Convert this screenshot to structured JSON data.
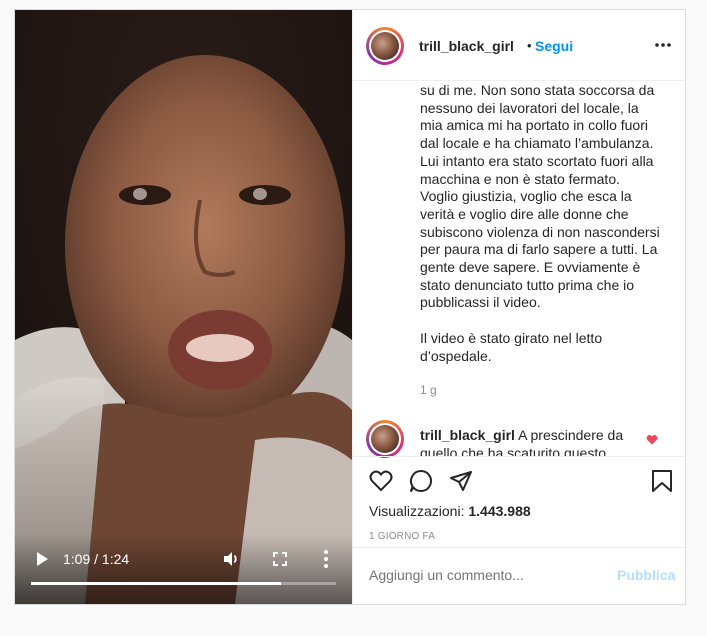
{
  "video": {
    "time": "1:09 / 1:24",
    "progress": 0.82,
    "icons": [
      "play-icon",
      "volume-icon",
      "fullscreen-icon",
      "more-options-icon"
    ]
  },
  "header": {
    "username": "trill_black_girl",
    "separator": "•",
    "follow_label": "Segui"
  },
  "caption": {
    "lines": [
      "su di me. Non sono stata soccorsa da",
      "nessuno dei lavoratori del locale, la",
      "mia amica mi ha portato in collo fuori",
      "dal locale e ha chiamato l’ambulanza.",
      "Lui intanto era stato scortato fuori alla",
      "macchina e non è stato fermato.",
      "Voglio giustizia, voglio che esca la",
      "verità e voglio dire alle donne che",
      "subiscono violenza di non nascondersi",
      "per paura ma di farlo sapere a tutti. La",
      "gente deve sapere. E ovviamente è",
      "stato denunciato tutto prima che io",
      "pubblicassi il video."
    ],
    "lines2": [
      "Il video è stato girato nel letto",
      "d’ospedale."
    ],
    "age": "1 g"
  },
  "comment": {
    "username": "trill_black_girl",
    "text": "A prescindere da",
    "text2": "quello che ha scaturito questo"
  },
  "stats": {
    "views_label": "Visualizzazioni:",
    "views_value": "1.443.988",
    "date": "1 GIORNO FA"
  },
  "add_comment": {
    "placeholder": "Aggiungi un commento...",
    "publish_label": "Pubblica"
  },
  "colors": {
    "accent": "#0095f6",
    "heart": "#ed4956",
    "publish_disabled": "#b2dffc"
  }
}
